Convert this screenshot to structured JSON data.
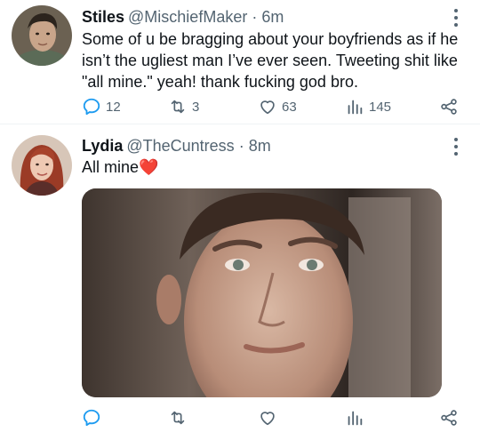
{
  "tweets": [
    {
      "name": "Stiles",
      "handle": "@MischiefMaker",
      "separator": "·",
      "time": "6m",
      "text": "Some of u be bragging about your boyfriends as if he isn’t the ugliest man I’ve ever seen. Tweeting shit like \"all mine.\" yeah! thank fucking god bro.",
      "replies": "12",
      "retweets": "3",
      "likes": "63",
      "views": "145"
    },
    {
      "name": "Lydia",
      "handle": "@TheCuntress",
      "separator": "·",
      "time": "8m",
      "text": "All mine❤️",
      "replies": "",
      "retweets": "",
      "likes": "",
      "views": ""
    }
  ],
  "icons": {
    "reply": "reply-icon",
    "retweet": "retweet-icon",
    "like": "heart-icon",
    "views": "views-icon",
    "share": "share-icon",
    "more": "more-icon"
  },
  "colors": {
    "text": "#0f1419",
    "secondary": "#536471",
    "reply_icon": "#1d9bf0",
    "divider": "#eff3f4"
  }
}
